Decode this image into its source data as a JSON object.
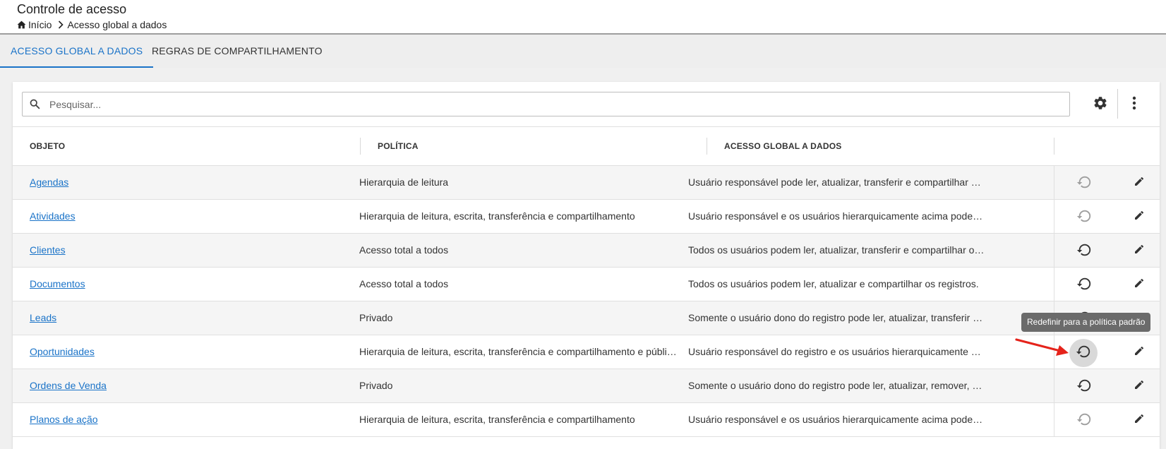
{
  "header": {
    "title": "Controle de acesso",
    "breadcrumb": {
      "home": "Início",
      "current": "Acesso global a dados"
    }
  },
  "tabs": [
    {
      "label": "ACESSO GLOBAL A DADOS",
      "active": true
    },
    {
      "label": "REGRAS DE COMPARTILHAMENTO",
      "active": false
    }
  ],
  "search": {
    "placeholder": "Pesquisar...",
    "value": ""
  },
  "table": {
    "columns": [
      "OBJETO",
      "POLÍTICA",
      "ACESSO GLOBAL A DADOS"
    ],
    "rows": [
      {
        "object": "Agendas",
        "policy": "Hierarquia de leitura",
        "access": "Usuário responsável pode ler, atualizar, transferir e compartilhar os registros.",
        "reset_enabled": false
      },
      {
        "object": "Atividades",
        "policy": "Hierarquia de leitura, escrita, transferência e compartilhamento",
        "access": "Usuário responsável e os usuários hierarquicamente acima podem ler, atualizar, transferir e compartilhar os registros.",
        "reset_enabled": false
      },
      {
        "object": "Clientes",
        "policy": "Acesso total a todos",
        "access": "Todos os usuários podem ler, atualizar, transferir e compartilhar os registros.",
        "reset_enabled": true
      },
      {
        "object": "Documentos",
        "policy": "Acesso total a todos",
        "access": "Todos os usuários podem ler, atualizar e compartilhar os registros.",
        "reset_enabled": true
      },
      {
        "object": "Leads",
        "policy": "Privado",
        "access": "Somente o usuário dono do registro pode ler, atualizar, transferir e compartilhar os registros.",
        "reset_enabled": true
      },
      {
        "object": "Oportunidades",
        "policy": "Hierarquia de leitura, escrita, transferência e compartilhamento e público",
        "access": "Usuário responsável do registro e os usuários hierarquicamente acima podem ler, atualizar, transferir e compartilhar os registros.",
        "reset_enabled": true,
        "hovered": true
      },
      {
        "object": "Ordens de Venda",
        "policy": "Privado",
        "access": "Somente o usuário dono do registro pode ler, atualizar, remover, transferir e compartilhar os registros.",
        "reset_enabled": true
      },
      {
        "object": "Planos de ação",
        "policy": "Hierarquia de leitura, escrita, transferência e compartilhamento",
        "access": "Usuário responsável e os usuários hierarquicamente acima podem ler, atualizar, transferir e compartilhar os registros.",
        "reset_enabled": false
      }
    ]
  },
  "tooltip": {
    "text": "Redefinir para a política padrão"
  },
  "icons": {
    "home": "home-icon",
    "chevron": "chevron-right-icon",
    "search": "search-icon",
    "settings": "gear-icon",
    "more": "more-vertical-icon",
    "reset": "restore-icon",
    "edit": "pencil-icon"
  },
  "colors": {
    "accent": "#1a73c8",
    "link": "#1a73c8",
    "annotation_arrow": "#e5231b",
    "tooltip_bg": "#6b6b6b"
  }
}
